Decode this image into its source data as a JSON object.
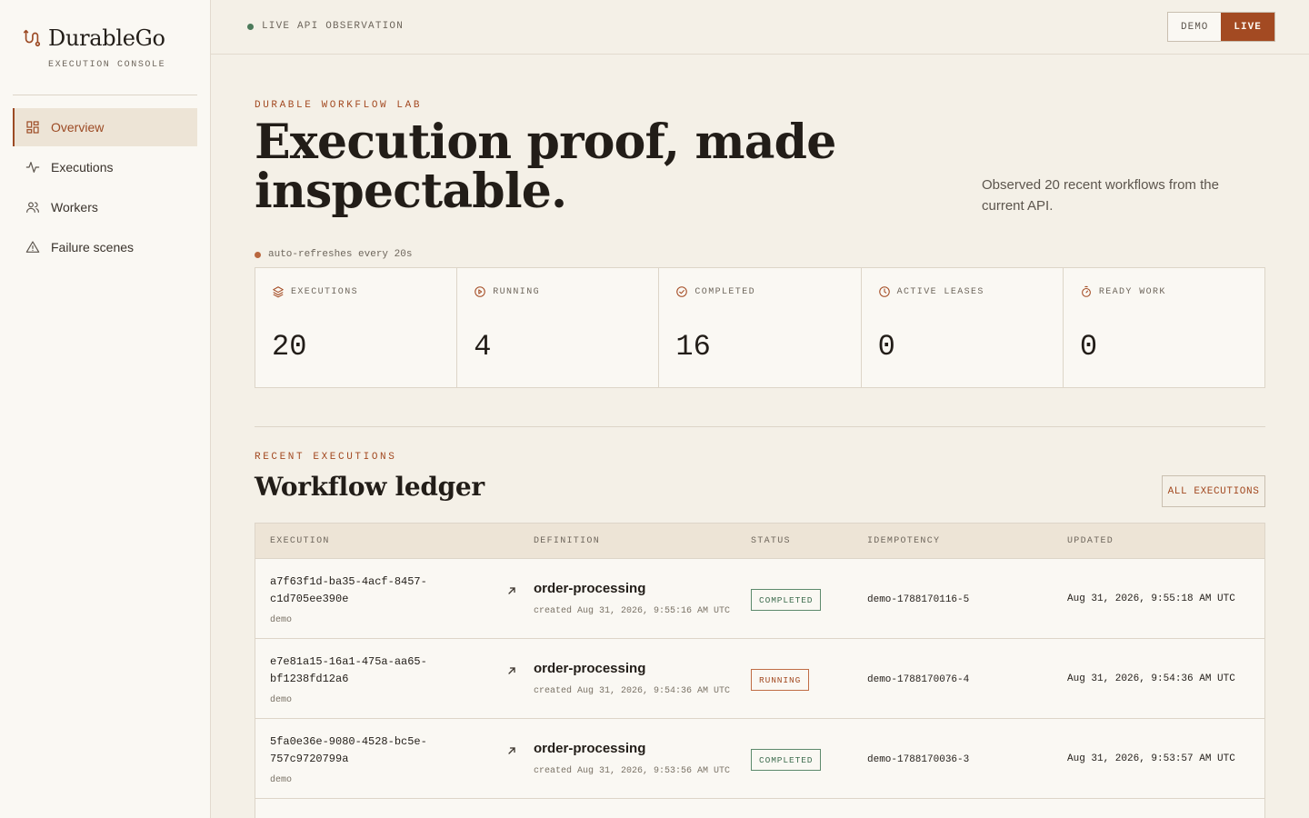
{
  "brand": {
    "name": "DurableGo",
    "subtitle": "EXECUTION CONSOLE"
  },
  "nav": {
    "items": [
      {
        "label": "Overview",
        "icon": "grid-icon",
        "active": true
      },
      {
        "label": "Executions",
        "icon": "activity-icon"
      },
      {
        "label": "Workers",
        "icon": "users-icon"
      },
      {
        "label": "Failure scenes",
        "icon": "warning-icon"
      }
    ]
  },
  "topbar": {
    "status": "LIVE API OBSERVATION",
    "modes": {
      "demo": "DEMO",
      "live": "LIVE"
    },
    "active_mode": "LIVE"
  },
  "hero": {
    "eyebrow": "DURABLE WORKFLOW LAB",
    "title": "Execution proof, made inspectable.",
    "note": "Observed 20 recent workflows from the current API.",
    "refresh": "auto-refreshes every 20s"
  },
  "stats": [
    {
      "label": "EXECUTIONS",
      "value": "20",
      "icon": "layers-icon"
    },
    {
      "label": "RUNNING",
      "value": "4",
      "icon": "play-circle-icon"
    },
    {
      "label": "COMPLETED",
      "value": "16",
      "icon": "check-circle-icon"
    },
    {
      "label": "ACTIVE LEASES",
      "value": "0",
      "icon": "clock-icon"
    },
    {
      "label": "READY WORK",
      "value": "0",
      "icon": "timer-icon"
    }
  ],
  "recent": {
    "eyebrow": "RECENT EXECUTIONS",
    "title": "Workflow ledger",
    "all_button": "ALL EXECUTIONS",
    "columns": [
      "EXECUTION",
      "DEFINITION",
      "STATUS",
      "IDEMPOTENCY",
      "UPDATED"
    ],
    "rows": [
      {
        "id_line1": "a7f63f1d-ba35-4acf-8457-",
        "id_line2": "c1d705ee390e",
        "namespace": "demo",
        "definition": "order-processing",
        "created": "created Aug 31, 2026, 9:55:16 AM UTC",
        "status": "COMPLETED",
        "idempotency": "demo-1788170116-5",
        "updated": "Aug 31, 2026, 9:55:18 AM UTC"
      },
      {
        "id_line1": "e7e81a15-16a1-475a-aa65-",
        "id_line2": "bf1238fd12a6",
        "namespace": "demo",
        "definition": "order-processing",
        "created": "created Aug 31, 2026, 9:54:36 AM UTC",
        "status": "RUNNING",
        "idempotency": "demo-1788170076-4",
        "updated": "Aug 31, 2026, 9:54:36 AM UTC"
      },
      {
        "id_line1": "5fa0e36e-9080-4528-bc5e-",
        "id_line2": "757c9720799a",
        "namespace": "demo",
        "definition": "order-processing",
        "created": "created Aug 31, 2026, 9:53:56 AM UTC",
        "status": "COMPLETED",
        "idempotency": "demo-1788170036-3",
        "updated": "Aug 31, 2026, 9:53:57 AM UTC"
      }
    ]
  },
  "colors": {
    "accent": "#a34a22",
    "background": "#f4f0e7",
    "sidebar": "#faf8f3",
    "success": "#3f6d4f"
  }
}
